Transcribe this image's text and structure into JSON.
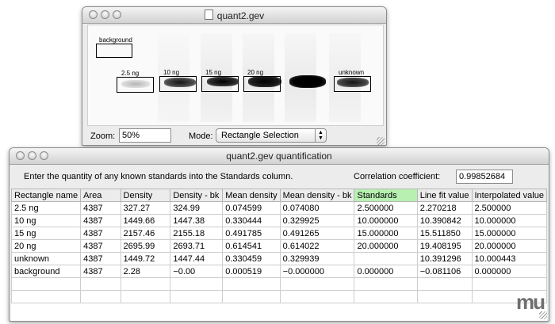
{
  "gel_window": {
    "title": "quant2.gev",
    "zoom_label": "Zoom:",
    "zoom_value": "50%",
    "mode_label": "Mode:",
    "mode_value": "Rectangle Selection",
    "rect_labels": {
      "background": "background",
      "r1": "2.5 ng",
      "r2": "10 ng",
      "r3": "15 ng",
      "r4": "20 ng",
      "r5": "unknown"
    }
  },
  "quant_window": {
    "title": "quant2.gev quantification",
    "instruction": "Enter the quantity of any known standards into the Standards column.",
    "correlation_label": "Correlation coefficient:",
    "correlation_value": "0.99852684",
    "columns": [
      "Rectangle name",
      "Area",
      "Density",
      "Density - bk",
      "Mean density",
      "Mean density - bk",
      "Standards",
      "Line fit value",
      "Interpolated value"
    ],
    "rows": [
      [
        "2.5 ng",
        "4387",
        "327.27",
        "324.99",
        "0.074599",
        "0.074080",
        "2.500000",
        "2.270218",
        "2.500000"
      ],
      [
        "10 ng",
        "4387",
        "1449.66",
        "1447.38",
        "0.330444",
        "0.329925",
        "10.000000",
        "10.390842",
        "10.000000"
      ],
      [
        "15 ng",
        "4387",
        "2157.46",
        "2155.18",
        "0.491785",
        "0.491265",
        "15.000000",
        "15.511850",
        "15.000000"
      ],
      [
        "20 ng",
        "4387",
        "2695.99",
        "2693.71",
        "0.614541",
        "0.614022",
        "20.000000",
        "19.408195",
        "20.000000"
      ],
      [
        "unknown",
        "4387",
        "1449.72",
        "1447.44",
        "0.330459",
        "0.329939",
        "",
        "10.391296",
        "10.000443"
      ],
      [
        "background",
        "4387",
        "2.28",
        "−0.00",
        "0.000519",
        "−0.000000",
        "0.000000",
        "−0.081106",
        "0.000000"
      ],
      [
        "",
        "",
        "",
        "",
        "",
        "",
        "",
        "",
        ""
      ],
      [
        "",
        "",
        "",
        "",
        "",
        "",
        "",
        "",
        ""
      ]
    ],
    "watermark": "mu"
  }
}
